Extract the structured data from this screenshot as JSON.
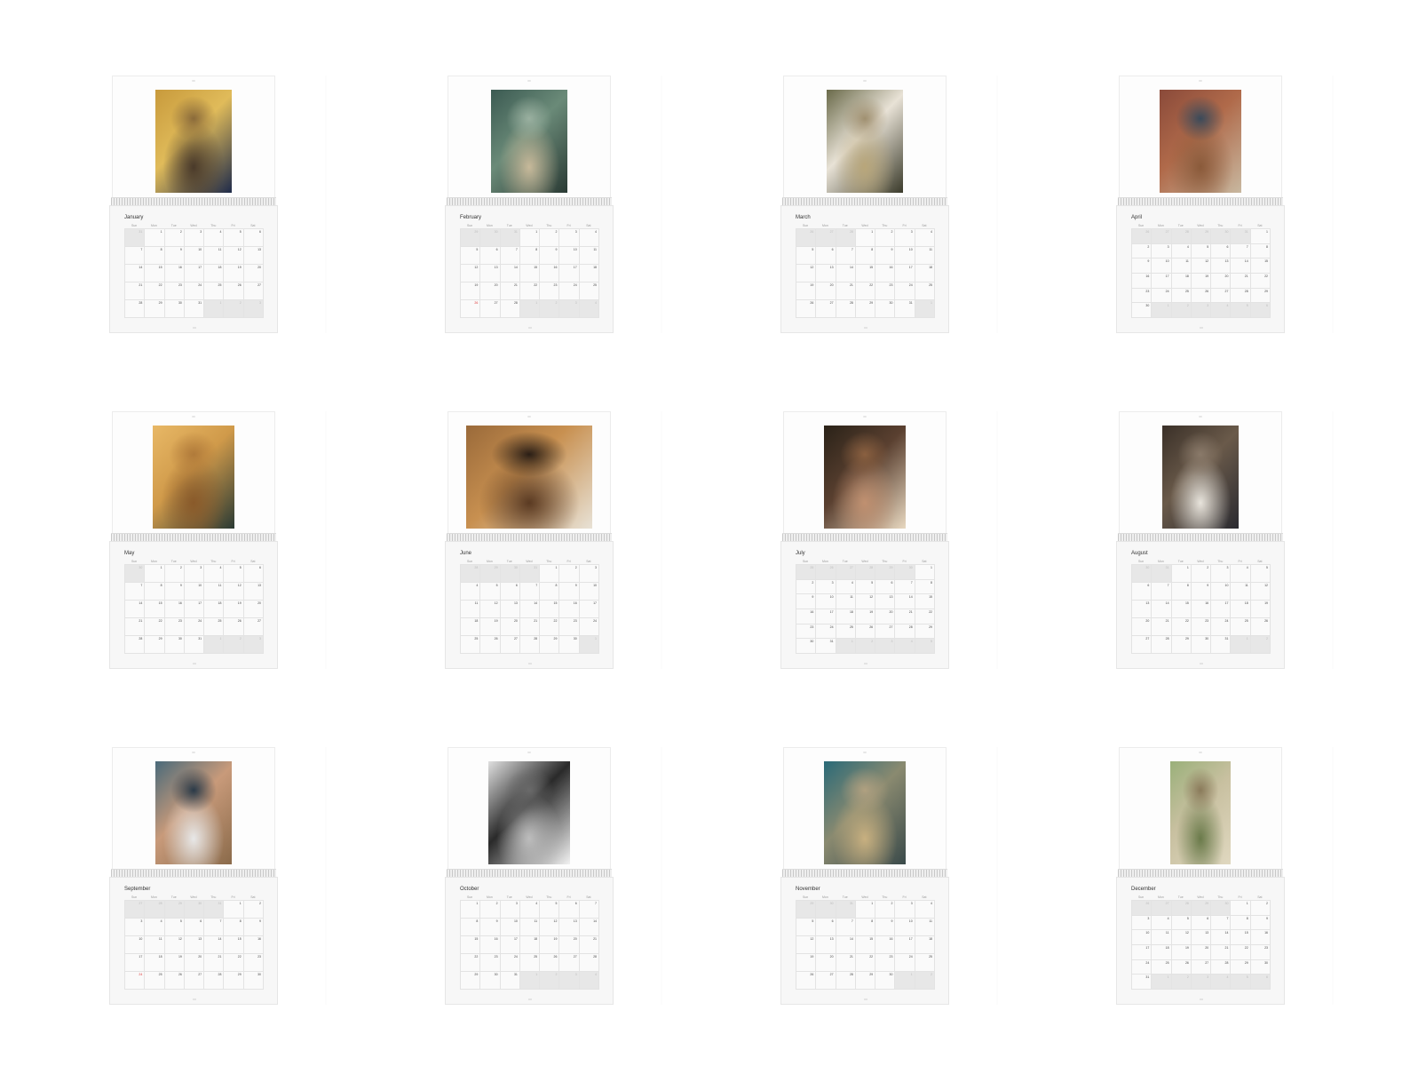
{
  "weekday_labels": [
    "Sun",
    "Mon",
    "Tue",
    "Wed",
    "Thu",
    "Fri",
    "Sat"
  ],
  "calendars": [
    {
      "month": "January",
      "start": 1,
      "days": 31,
      "prev_days": 31,
      "red": [],
      "photo": {
        "width": 86,
        "colors": [
          "#c89a3c",
          "#e0bb5a",
          "#4a3a2a",
          "#1e2a4a",
          "#8a6a3a"
        ]
      }
    },
    {
      "month": "February",
      "start": 3,
      "days": 28,
      "prev_days": 31,
      "red": [
        26
      ],
      "photo": {
        "width": 86,
        "colors": [
          "#3b5a52",
          "#6a8a78",
          "#c7b99a",
          "#2a3a34",
          "#9ab0a0"
        ]
      }
    },
    {
      "month": "March",
      "start": 3,
      "days": 31,
      "prev_days": 28,
      "red": [],
      "photo": {
        "width": 86,
        "colors": [
          "#6a6a4a",
          "#e8e2d6",
          "#b8a67a",
          "#3a3a2a",
          "#a09070"
        ]
      }
    },
    {
      "month": "April",
      "start": 6,
      "days": 30,
      "prev_days": 31,
      "red": [],
      "photo": {
        "width": 92,
        "colors": [
          "#8a4a3a",
          "#b06a4a",
          "#8a5a3a",
          "#c8b8a0",
          "#3a4a5a"
        ]
      }
    },
    {
      "month": "May",
      "start": 1,
      "days": 31,
      "prev_days": 30,
      "red": [],
      "photo": {
        "width": 92,
        "colors": [
          "#e8b866",
          "#d09a4a",
          "#8a5a2a",
          "#2a3a34",
          "#b07a3a"
        ]
      }
    },
    {
      "month": "June",
      "start": 4,
      "days": 30,
      "prev_days": 31,
      "red": [],
      "photo": {
        "width": 142,
        "colors": [
          "#9a6a3a",
          "#c89050",
          "#5a3a22",
          "#e8e2d6",
          "#2a1e16"
        ]
      }
    },
    {
      "month": "July",
      "start": 6,
      "days": 31,
      "prev_days": 30,
      "red": [],
      "photo": {
        "width": 92,
        "colors": [
          "#2a2218",
          "#5a4030",
          "#c09070",
          "#e8d8c0",
          "#8a6040"
        ]
      }
    },
    {
      "month": "August",
      "start": 2,
      "days": 31,
      "prev_days": 31,
      "red": [],
      "photo": {
        "width": 86,
        "colors": [
          "#3a3028",
          "#6a5a4a",
          "#e8e4dc",
          "#2a2a30",
          "#8a7a6a"
        ]
      }
    },
    {
      "month": "September",
      "start": 5,
      "days": 30,
      "prev_days": 31,
      "red": [
        24
      ],
      "photo": {
        "width": 86,
        "colors": [
          "#4a6a7a",
          "#c89a7a",
          "#e8e8e8",
          "#8a6a4a",
          "#2a3a48"
        ]
      }
    },
    {
      "month": "October",
      "start": 0,
      "days": 31,
      "prev_days": 30,
      "red": [],
      "photo": {
        "width": 92,
        "colors": [
          "#e0e0e0",
          "#2a2a2a",
          "#bdbdbd",
          "#f2f2f2",
          "#6a6a6a"
        ]
      }
    },
    {
      "month": "November",
      "start": 3,
      "days": 30,
      "prev_days": 31,
      "red": [],
      "photo": {
        "width": 92,
        "colors": [
          "#2a6a78",
          "#8a8a70",
          "#c8b080",
          "#3a4a4a",
          "#b0a080"
        ]
      }
    },
    {
      "month": "December",
      "start": 5,
      "days": 31,
      "prev_days": 30,
      "red": [],
      "photo": {
        "width": 68,
        "colors": [
          "#9ab07a",
          "#c8c0a0",
          "#6a7a4a",
          "#e0d8c0",
          "#8a7a5a"
        ]
      }
    }
  ]
}
